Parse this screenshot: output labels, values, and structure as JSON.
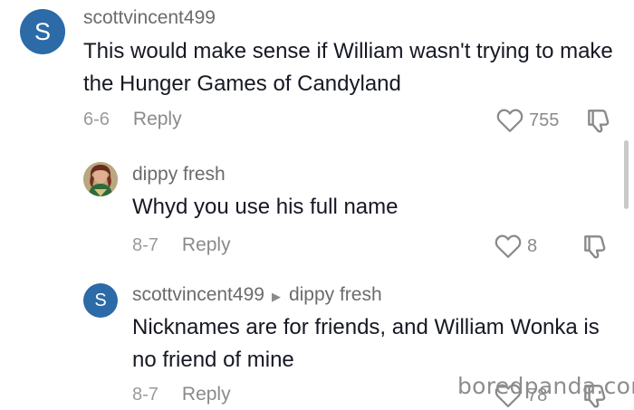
{
  "comments": [
    {
      "avatar_letter": "S",
      "avatar_color": "#2c6aa8",
      "username": "scottvincent499",
      "text": "This would make sense if William wasn't trying to make the Hunger Games of Candyland",
      "date": "6-6",
      "reply_label": "Reply",
      "likes": "755"
    },
    {
      "avatar_icon": "profile-photo",
      "username": "dippy fresh",
      "text": "Whyd you use his full name",
      "date": "8-7",
      "reply_label": "Reply",
      "likes": "8"
    },
    {
      "avatar_letter": "S",
      "avatar_color": "#2c6aa8",
      "username": "scottvincent499",
      "reply_to": "dippy fresh",
      "text": "Nicknames are for friends, and William Wonka is no friend of mine",
      "date": "8-7",
      "reply_label": "Reply",
      "likes": "78"
    }
  ],
  "watermark": "boredpanda.com",
  "colors": {
    "avatar_blue": "#2c6aa8",
    "icon_gray": "#8a8a8a"
  }
}
